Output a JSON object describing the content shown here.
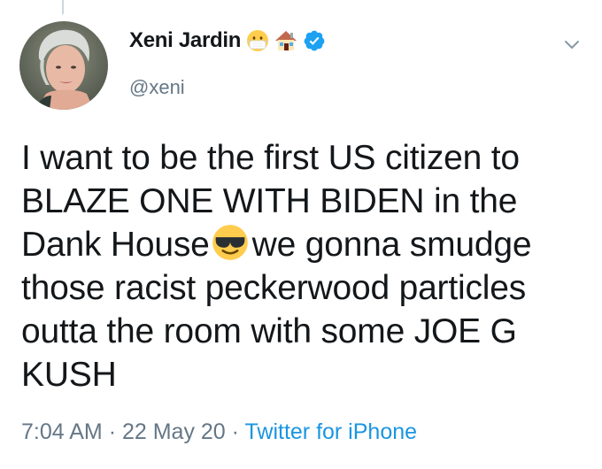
{
  "tweet": {
    "author": {
      "display_name": "Xeni Jardin",
      "handle": "@xeni",
      "name_emojis": [
        "mask-face-icon",
        "house-icon"
      ],
      "verified": true
    },
    "text_parts": {
      "before_emoji": "I want to be the first US citizen to BLAZE ONE WITH BIDEN in the Dank House",
      "after_emoji": "we gonna smudge those racist peckerwood particles outta the room with some JOE G KUSH"
    },
    "inline_emoji": "sunglasses-face-icon",
    "time": "7:04 AM",
    "separator": "·",
    "date": "22 May 20",
    "source": "Twitter for iPhone"
  },
  "colors": {
    "verified_blue": "#1da1f2",
    "link_blue": "#1b95e0",
    "secondary_gray": "#657786",
    "text_primary": "#14171a"
  }
}
